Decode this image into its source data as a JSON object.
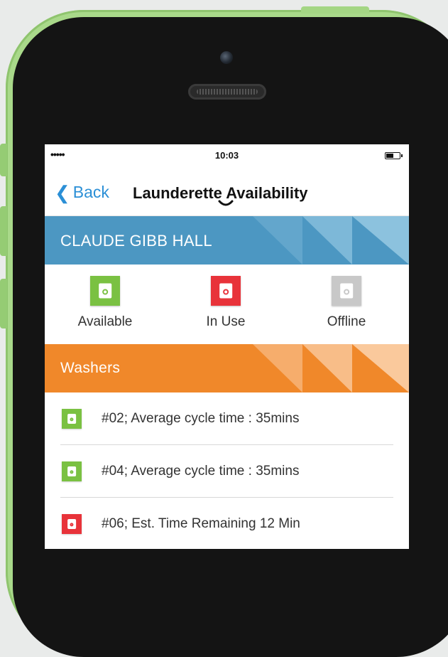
{
  "status_bar": {
    "signal": "•••••",
    "time": "10:03"
  },
  "nav": {
    "back_label": "Back",
    "title": "Launderette Availability"
  },
  "hall": {
    "name": "CLAUDE GIBB HALL"
  },
  "legend": [
    {
      "label": "Available",
      "color": "#7ac142",
      "icon": "washer-icon"
    },
    {
      "label": "In Use",
      "color": "#e8333a",
      "icon": "washer-icon"
    },
    {
      "label": "Offline",
      "color": "#c8c8c8",
      "icon": "washer-icon"
    }
  ],
  "section": {
    "title": "Washers"
  },
  "machines": [
    {
      "text": "#02; Average cycle time : 35mins",
      "status": "available",
      "color": "#7ac142"
    },
    {
      "text": "#04; Average cycle time : 35mins",
      "status": "available",
      "color": "#7ac142"
    },
    {
      "text": "#06; Est. Time Remaining 12 Min",
      "status": "in-use",
      "color": "#e8333a"
    }
  ],
  "colors": {
    "accent_blue": "#2b8fd6",
    "hall_banner": "#4c97c2",
    "washers_banner": "#f0882a",
    "phone_body": "#a9d98a"
  }
}
